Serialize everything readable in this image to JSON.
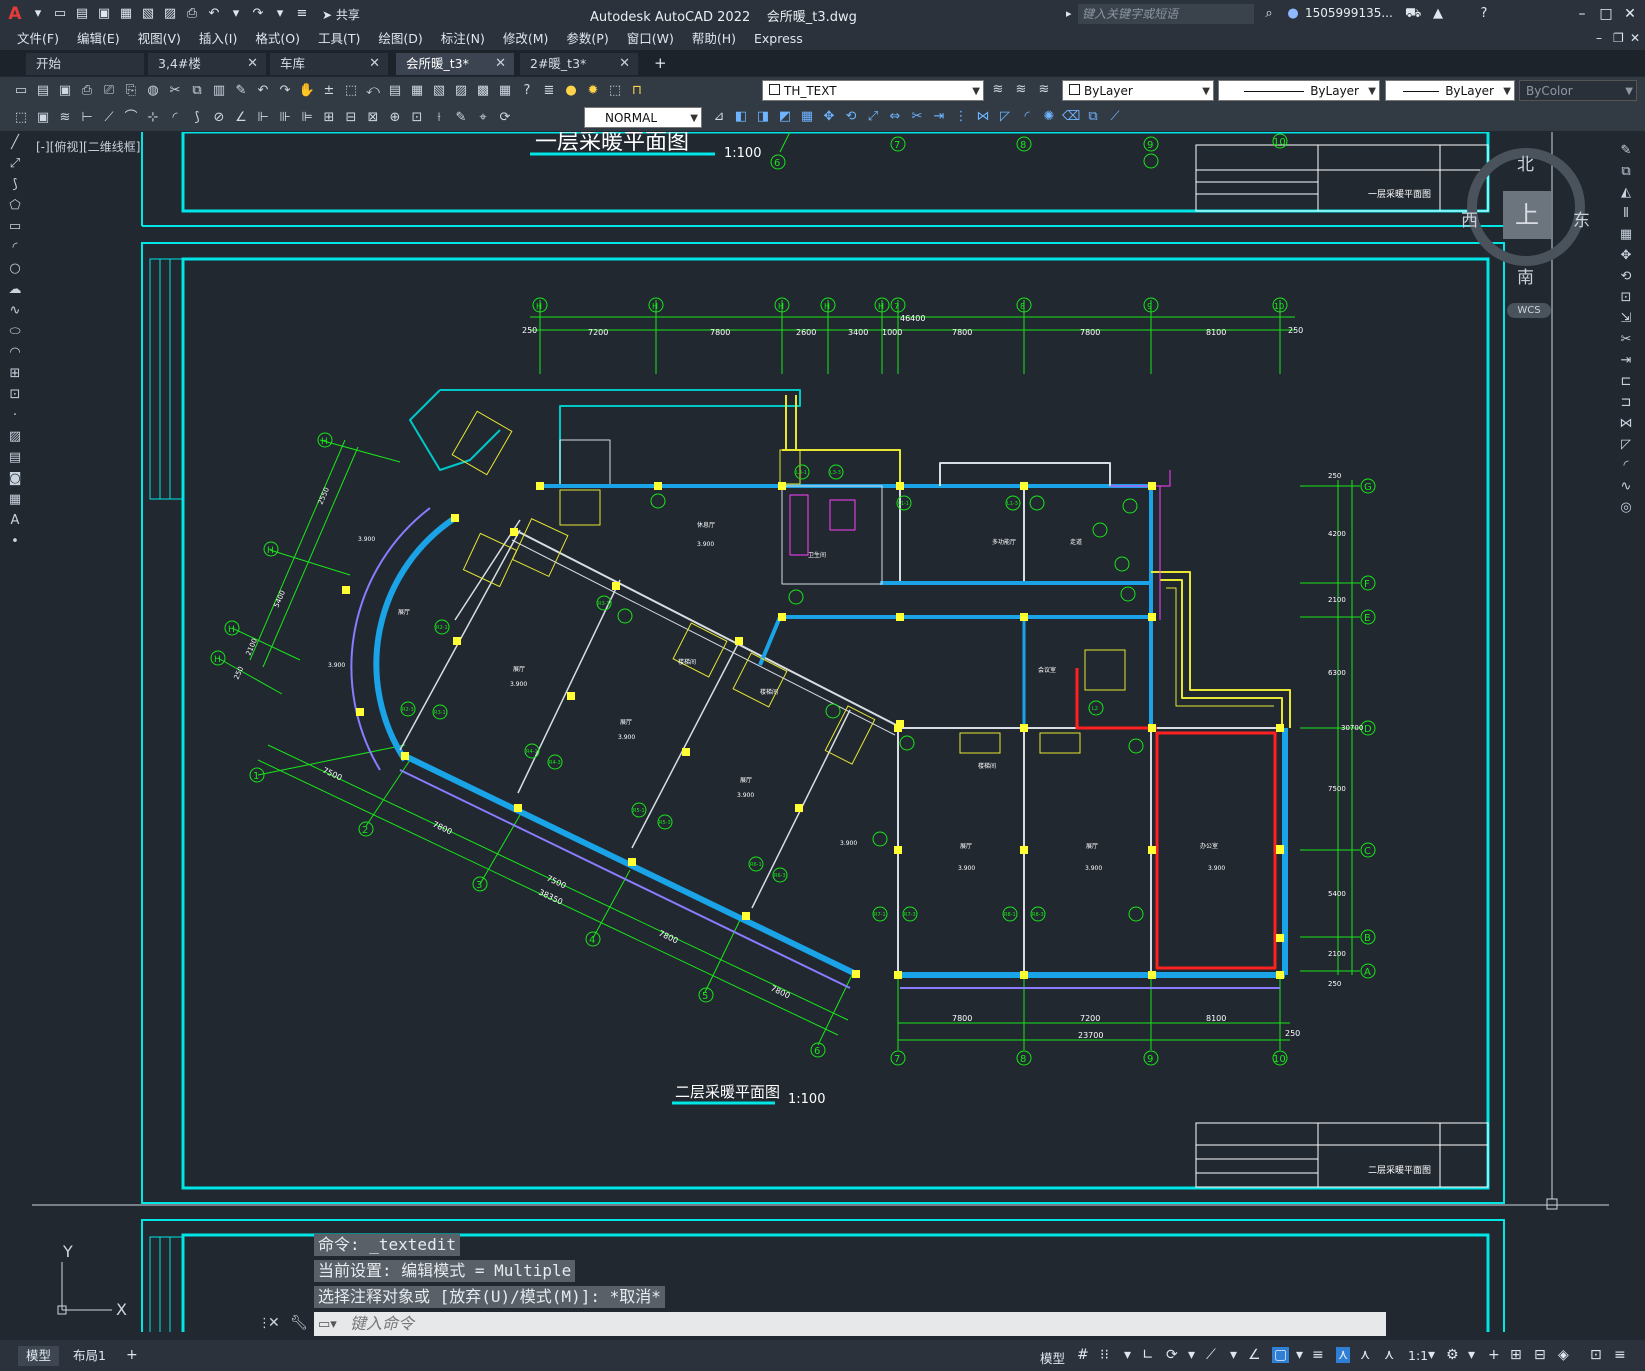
{
  "titlebar": {
    "app_title": "Autodesk AutoCAD 2022",
    "file_name": "会所暖_t3.dwg",
    "share_label": "共享",
    "search_placeholder": "键入关键字或短语",
    "user_name": "1505999135..."
  },
  "menu": [
    "文件(F)",
    "编辑(E)",
    "视图(V)",
    "插入(I)",
    "格式(O)",
    "工具(T)",
    "绘图(D)",
    "标注(N)",
    "修改(M)",
    "参数(P)",
    "窗口(W)",
    "帮助(H)",
    "Express"
  ],
  "tabs": [
    {
      "label": "开始"
    },
    {
      "label": "3,4#楼"
    },
    {
      "label": "车库"
    },
    {
      "label": "会所暖_t3*"
    },
    {
      "label": "2#暖_t3*"
    }
  ],
  "toolbar": {
    "layer_combo": "TH_TEXT",
    "color_combo": "ByLayer",
    "linetype_combo": "ByLayer",
    "lineweight_combo": "ByLayer",
    "plotstyle_combo": "ByColor",
    "textstyle_combo": "NORMAL"
  },
  "viewport": {
    "view_label": "[-][俯视][二维线框]",
    "compass_north": "北",
    "compass_south": "南",
    "compass_east": "东",
    "compass_west": "西",
    "cube_face": "上",
    "wcs_label": "WCS"
  },
  "drawing": {
    "top_plan_title": "一层采暖平面图",
    "top_plan_scale": "1:100",
    "main_plan_title": "二层采暖平面图",
    "main_plan_scale": "1:100",
    "top_axis_numbers": [
      "6",
      "7",
      "8",
      "9",
      "10"
    ],
    "top_axes": [
      "H",
      "H",
      "H",
      "H",
      "H",
      "7",
      "8",
      "9",
      "10"
    ],
    "top_dims": [
      "250",
      "7200",
      "7800",
      "2600",
      "3400",
      "1000",
      "7800",
      "7800",
      "8100",
      "250"
    ],
    "overall_dim_top": "46400",
    "right_axes": [
      "G",
      "F",
      "E",
      "D",
      "C",
      "B",
      "A"
    ],
    "right_dims": [
      "250",
      "4200",
      "2100",
      "6300",
      "7500",
      "5400",
      "2100",
      "250"
    ],
    "right_overall_dim": "30700",
    "bottom_axes": [
      "7",
      "8",
      "9",
      "10"
    ],
    "bottom_dims": [
      "7800",
      "7200",
      "8100",
      "250"
    ],
    "bottom_overall_dim": "23700",
    "diag_axes": [
      "1",
      "2",
      "3",
      "4",
      "5",
      "6"
    ],
    "diag_dims": [
      "7500",
      "7800",
      "7500",
      "7800",
      "7800"
    ],
    "diag_overall_dim": "38350",
    "left_axes": [
      "H",
      "H",
      "H",
      "H"
    ],
    "left_dims": [
      "2550",
      "5400",
      "2100",
      "250"
    ],
    "elevation_labels": [
      "3.900",
      "3.900",
      "3.900",
      "3.900",
      "3.900",
      "3.900",
      "3.900",
      "3.900",
      "3.900",
      "3.900"
    ],
    "room_labels": [
      "休息厅",
      "多功能厅",
      "走道",
      "展厅",
      "展厅",
      "展厅",
      "展厅",
      "展厅",
      "展厅",
      "办公室",
      "会议室",
      "卫生间",
      "楼梯间",
      "楼梯间",
      "楼梯间"
    ],
    "riser_tags": [
      "R2-1",
      "R2-3",
      "R3-1",
      "R3-3",
      "R4-1",
      "R4-3",
      "R5-1",
      "R5-3",
      "R6-1",
      "R6-3",
      "R7-1",
      "R7-3",
      "R8-1",
      "R8-3",
      "L1-1",
      "L1-3",
      "L2",
      "L3-1",
      "L3-3"
    ],
    "title_block_name_top": "一层采暖平面图",
    "title_block_name_main": "二层采暖平面图"
  },
  "command": {
    "history": [
      "命令: _textedit",
      "当前设置: 编辑模式 = Multiple",
      "选择注释对象或 [放弃(U)/模式(M)]: *取消*"
    ],
    "input_placeholder": "键入命令"
  },
  "ucs": {
    "x_label": "X",
    "y_label": "Y"
  },
  "status": {
    "layout_tabs": [
      "模型",
      "布局1"
    ],
    "model_label": "模型",
    "scale_label": "1:1"
  },
  "colors": {
    "cyan_frame": "#00e5e5",
    "green_axis": "#19e619",
    "yellow_column": "#ffff33",
    "blue_wall": "#1aa3e6",
    "red_pipe": "#ff2020"
  }
}
